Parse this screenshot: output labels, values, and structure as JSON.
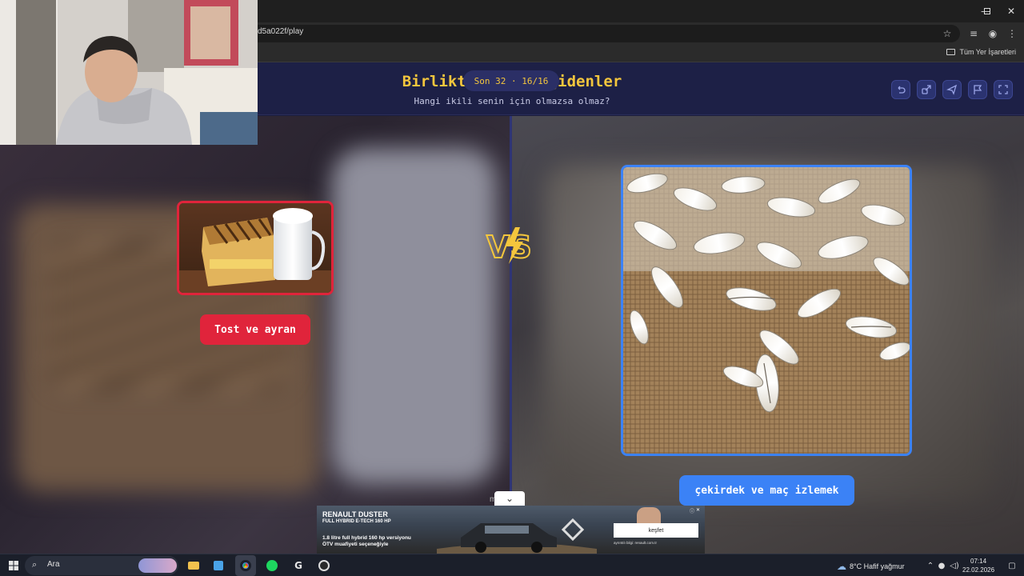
{
  "browser": {
    "url": "d5a022f/play",
    "bookmarks_label": "Tüm Yer İşaretleri"
  },
  "page": {
    "title": "Birlikte en iyi gidenler",
    "subtitle": "Hangi ikili senin için olmazsa olmaz?",
    "round_info": "Son 32 · 16/16",
    "vs_label": "VS"
  },
  "choices": {
    "left": {
      "label": "Tost ve ayran",
      "accent": "#e0243b"
    },
    "right": {
      "label": "çekirdek ve maç izlemek",
      "accent": "#3b82f6"
    }
  },
  "overlay": {
    "faint_text": "m         h"
  },
  "ad": {
    "title": "RENAULT DUSTER",
    "subtitle": "FULL HYBRID E-TECH 160 HP",
    "description": "1.8 litre full hybrid 160 hp versiyonu ÖTV muafiyeti seçeneğiyle",
    "cta": "keşfet",
    "legal": "ayrıntılı bilgi: renault.com.tr"
  },
  "taskbar": {
    "search_placeholder": "Ara",
    "weather": "8°C  Hafif yağmur",
    "time": "07:14",
    "date": "22.02.2026"
  },
  "colors": {
    "title_yellow": "#f4c63d",
    "header_bg": "#1d2046",
    "left_red": "#e0243b",
    "right_blue": "#3b82f6"
  }
}
